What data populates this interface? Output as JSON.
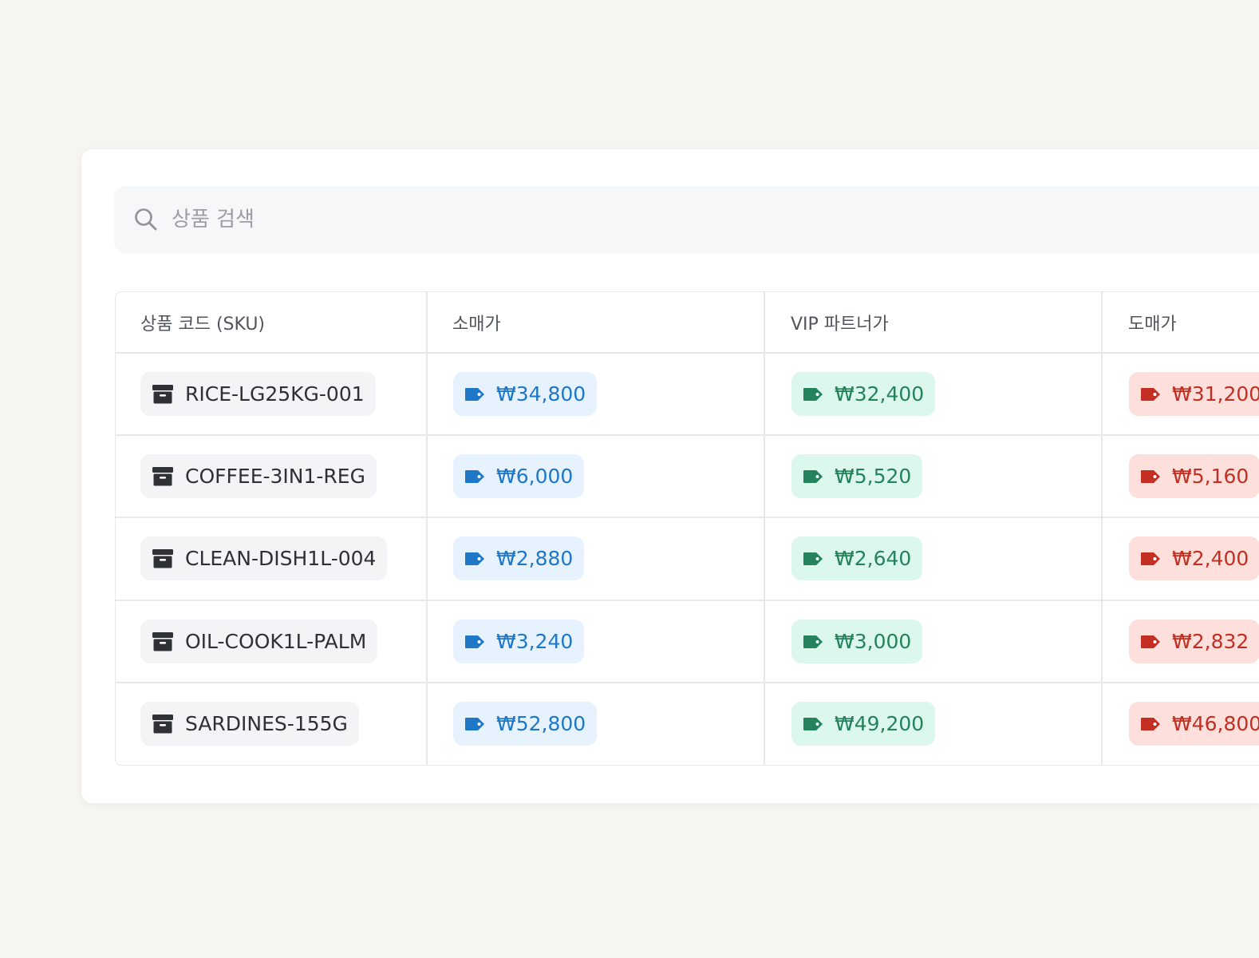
{
  "search": {
    "placeholder": "상품 검색",
    "value": ""
  },
  "table": {
    "headers": {
      "sku": "상품 코드 (SKU)",
      "retail": "소매가",
      "vip": "VIP 파트너가",
      "wholesale": "도매가"
    },
    "rows": [
      {
        "sku": "RICE-LG25KG-001",
        "retail": "₩34,800",
        "vip": "₩32,400",
        "wholesale": "₩31,200"
      },
      {
        "sku": "COFFEE-3IN1-REG",
        "retail": "₩6,000",
        "vip": "₩5,520",
        "wholesale": "₩5,160"
      },
      {
        "sku": "CLEAN-DISH1L-004",
        "retail": "₩2,880",
        "vip": "₩2,640",
        "wholesale": "₩2,400"
      },
      {
        "sku": "OIL-COOK1L-PALM",
        "retail": "₩3,240",
        "vip": "₩3,000",
        "wholesale": "₩2,832"
      },
      {
        "sku": "SARDINES-155G",
        "retail": "₩52,800",
        "vip": "₩49,200",
        "wholesale": "₩46,800"
      }
    ]
  },
  "icons": {
    "search": "search-icon",
    "sku": "archive-box-icon",
    "price": "price-tag-icon"
  },
  "colors": {
    "retail_text": "#1f77c7",
    "retail_bg": "#e6f2fd",
    "vip_text": "#24835c",
    "vip_bg": "#dcf7ee",
    "wholesale_text": "#c32f22",
    "wholesale_bg": "#fde0dc"
  }
}
